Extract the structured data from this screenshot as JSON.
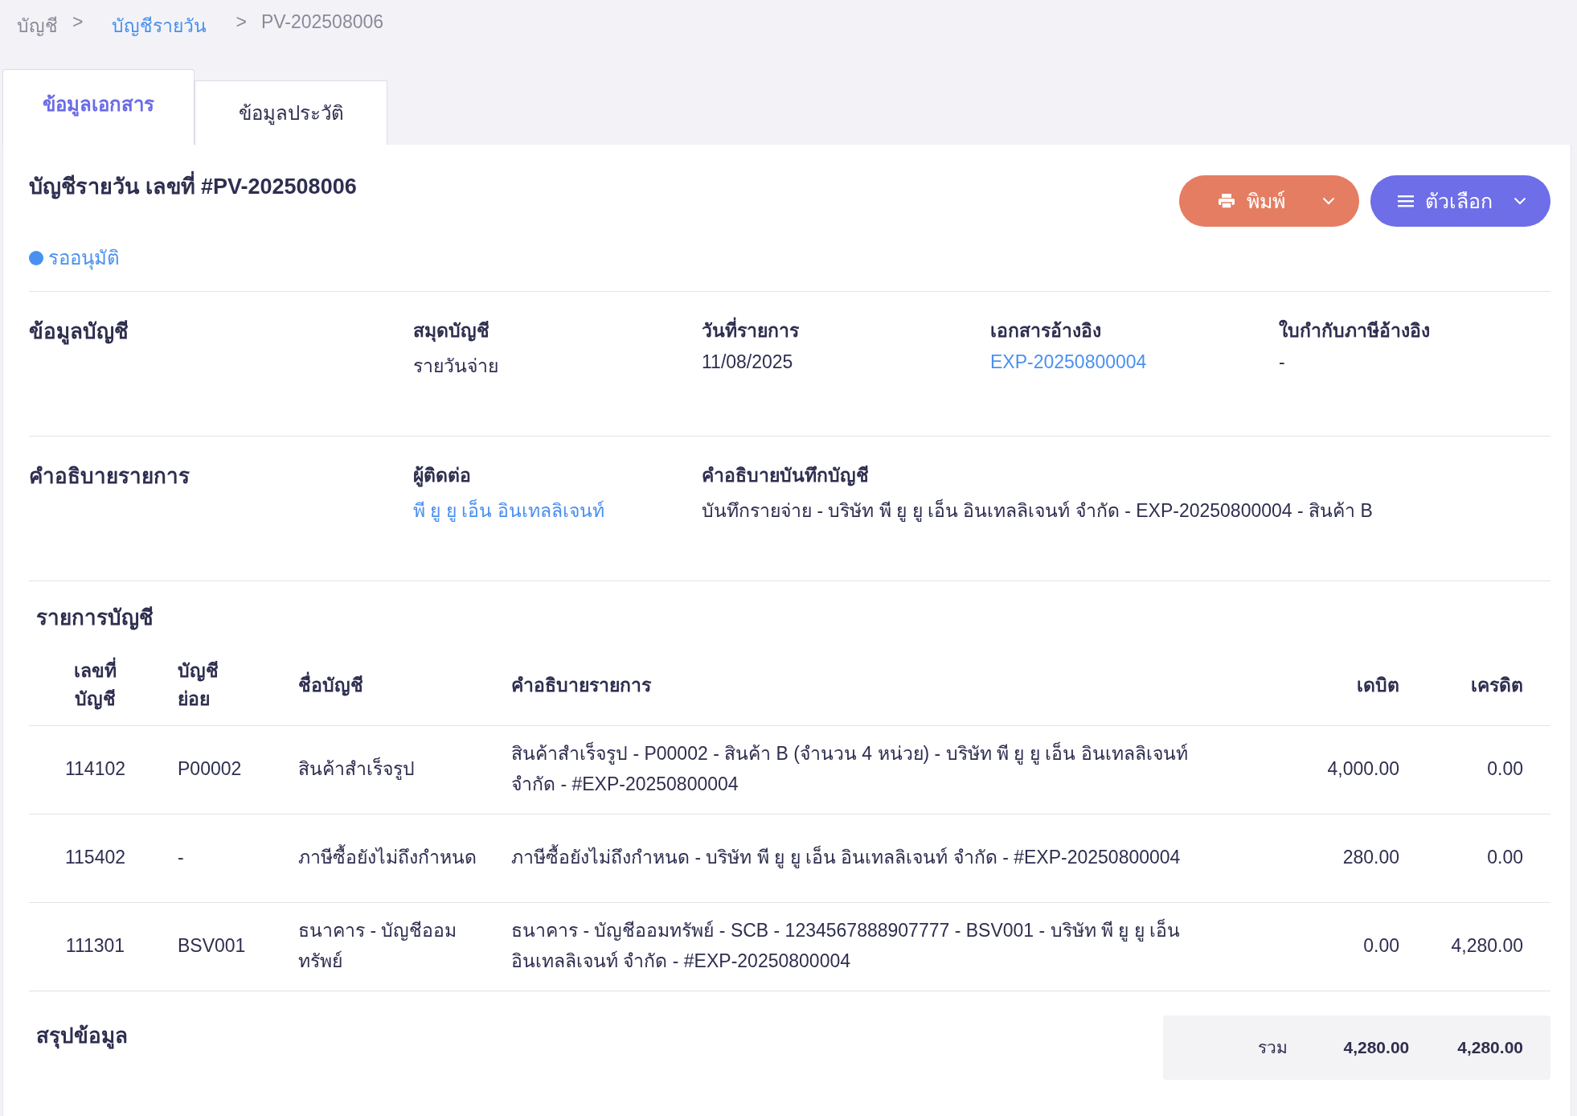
{
  "breadcrumb": [
    {
      "label": "บัญชี",
      "kind": "text"
    },
    {
      "label": ">",
      "kind": "separator"
    },
    {
      "label": "บัญชีรายวัน",
      "kind": "link"
    },
    {
      "label": ">",
      "kind": "separator"
    },
    {
      "label": "PV-202508006",
      "kind": "text"
    }
  ],
  "tabs": [
    {
      "label": "ข้อมูลเอกสาร",
      "selected": true
    },
    {
      "label": "ข้อมูลประวัติ",
      "selected": false
    }
  ],
  "title": "บัญชีรายวัน เลขที่ #PV-202508006",
  "buttons": [
    {
      "label": "พิมพ์",
      "kind": "print"
    },
    {
      "label": "ตัวเลือก",
      "kind": "menu"
    }
  ],
  "status": {
    "label": "รออนุมัติ",
    "color": "#4a90f0"
  },
  "sections": [
    {
      "heading": "ข้อมูลบัญชี",
      "fields": [
        {
          "label": "สมุดบัญชี",
          "value": "รายวันจ่าย",
          "kind": "text"
        },
        {
          "label": "วันที่รายการ",
          "value": "11/08/2025",
          "kind": "text"
        },
        {
          "label": "เอกสารอ้างอิง",
          "value": "EXP-20250800004",
          "kind": "link"
        },
        {
          "label": "ใบกำกับภาษีอ้างอิง",
          "value": "-",
          "kind": "text"
        }
      ]
    },
    {
      "heading": "คำอธิบายรายการ",
      "fields": [
        {
          "label": "ผู้ติดต่อ",
          "value": "พี ยู ยู เอ็น อินเทลลิเจนท์",
          "kind": "link"
        },
        {
          "label": "คำอธิบายบันทึกบัญชี",
          "value": "บันทึกรายจ่าย - บริษัท พี ยู ยู เอ็น อินเทลลิเจนท์ จำกัด - EXP-20250800004 - สินค้า B",
          "kind": "wide"
        }
      ]
    }
  ],
  "table": {
    "heading": "รายการบัญชี",
    "columns": [
      "เลขที่ บัญชี",
      "บัญชี ย่อย",
      "ชื่อบัญชี",
      "คำอธิบายรายการ",
      "เดบิต",
      "เครดิต"
    ],
    "rows": [
      [
        "114102",
        "P00002",
        "สินค้าสำเร็จรูป",
        "สินค้าสำเร็จรูป - P00002 - สินค้า B (จำนวน 4 หน่วย) - บริษัท พี ยู ยู เอ็น อินเทลลิเจนท์ จำกัด - #EXP-20250800004",
        "4,000.00",
        "0.00"
      ],
      [
        "115402",
        "-",
        "ภาษีซื้อยังไม่ถึงกำหนด",
        "ภาษีซื้อยังไม่ถึงกำหนด - บริษัท พี ยู ยู เอ็น อินเทลลิเจนท์ จำกัด - #EXP-20250800004",
        "280.00",
        "0.00"
      ],
      [
        "111301",
        "BSV001",
        "ธนาคาร - บัญชีออมทรัพย์",
        "ธนาคาร - บัญชีออมทรัพย์ - SCB - 1234567888907777 - BSV001 - บริษัท พี ยู ยู เอ็น อินเทลลิเจนท์ จำกัด - #EXP-20250800004",
        "0.00",
        "4,280.00"
      ]
    ]
  },
  "summary": {
    "heading": "สรุปข้อมูล",
    "total_label": "รวม",
    "debit": "4,280.00",
    "credit": "4,280.00"
  }
}
